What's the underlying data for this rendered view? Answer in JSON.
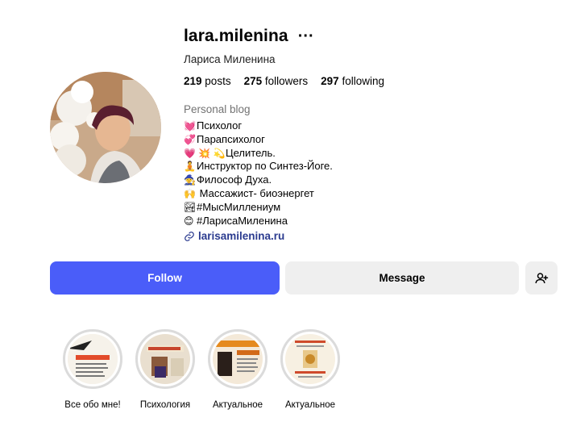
{
  "profile": {
    "username": "lara.milenina",
    "full_name": "Лариса Миленина",
    "stats": {
      "posts_count": "219",
      "posts_label": "posts",
      "followers_count": "275",
      "followers_label": "followers",
      "following_count": "297",
      "following_label": "following"
    },
    "category": "Personal blog",
    "bio": [
      {
        "emoji": "💓",
        "text": "Психолог"
      },
      {
        "emoji": "💞",
        "text": "Парапсихолог"
      },
      {
        "emoji": "💗 💥 💫",
        "text": "Целитель."
      },
      {
        "emoji": "🧘",
        "text": "Инструктор по Синтез-Йоге."
      },
      {
        "emoji": "🧙",
        "text": "Философ Духа."
      },
      {
        "emoji": "🙌",
        "text": " Массажист- биоэнергет"
      },
      {
        "emoji": "🏞",
        "text": "#МысМиллениум"
      },
      {
        "emoji": "😊",
        "text": "#ЛарисаМиленина"
      }
    ],
    "link": "larisamilenina.ru"
  },
  "actions": {
    "follow_label": "Follow",
    "message_label": "Message"
  },
  "highlights": [
    {
      "label": "Все обо мне!"
    },
    {
      "label": "Психология"
    },
    {
      "label": "Актуальное"
    },
    {
      "label": "Актуальное"
    }
  ],
  "colors": {
    "follow_bg": "#4a5df9",
    "secondary_bg": "#efefef",
    "link": "#2b3b8f",
    "muted": "#737373"
  }
}
